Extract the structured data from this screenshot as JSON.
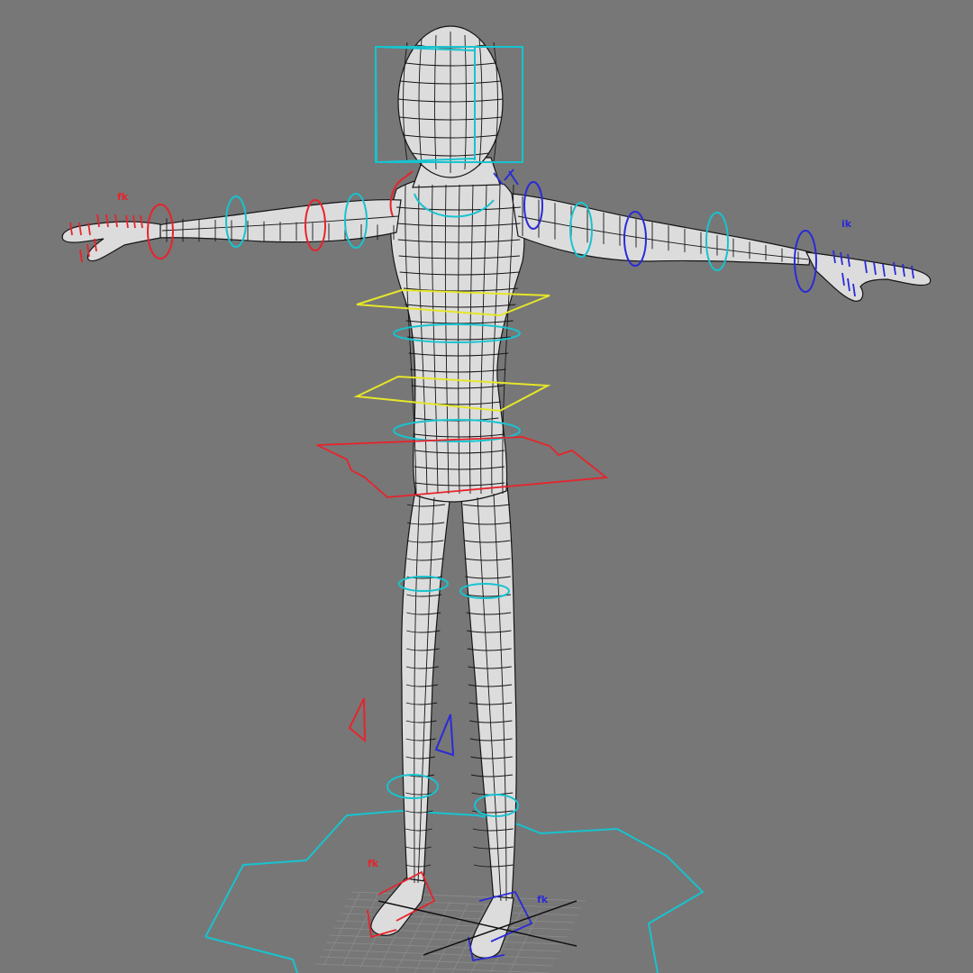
{
  "viewport": {
    "background": "#777777",
    "camera": "perspective",
    "selection_highlight": "none"
  },
  "colors": {
    "mesh_fill": "#dcdcdc",
    "mesh_wire": "#151515",
    "control_center": "#17c3cf",
    "control_left": "#e8232b",
    "control_right": "#2a2ad8",
    "control_torso": "#e6e62a"
  },
  "labels": {
    "left_hand_tag": "fk",
    "right_hand_tag": "ik",
    "left_foot_tag": "fk",
    "right_foot_tag": "fk"
  },
  "model": {
    "type": "character-mesh",
    "pose": "T-pose",
    "shading": "wireframe-on-shaded"
  },
  "icons": [
    "head-control-box-icon",
    "neck-control-ring-icon",
    "clavicle-control-icon",
    "arm-ring-control-icon",
    "hand-control-icon",
    "chest-control-icon",
    "spine-control-icon",
    "hips-control-icon",
    "knee-pole-vector-icon",
    "foot-control-icon",
    "world-control-icon",
    "ground-grid-icon"
  ]
}
